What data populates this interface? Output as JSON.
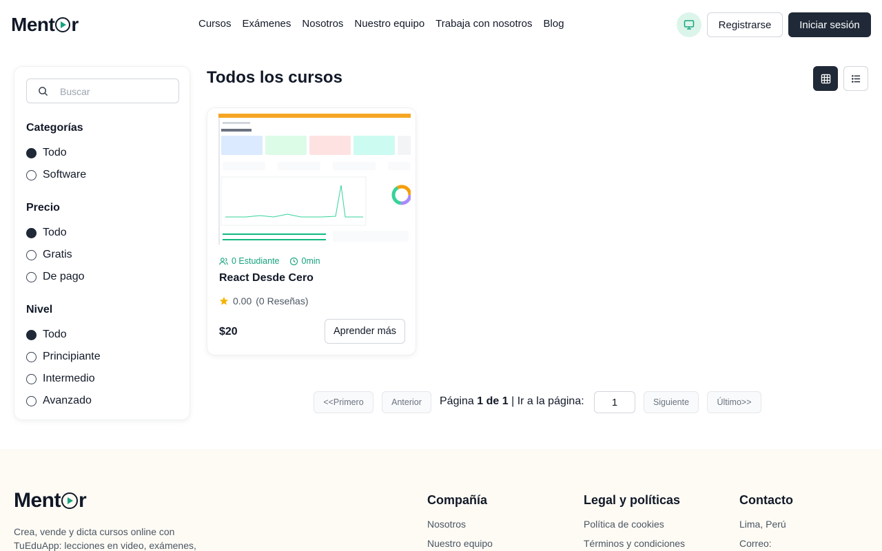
{
  "brand": {
    "name_prefix": "Ment",
    "name_suffix": "r"
  },
  "nav": [
    "Cursos",
    "Exámenes",
    "Nosotros",
    "Nuestro equipo",
    "Trabaja con nosotros",
    "Blog"
  ],
  "header": {
    "register_label": "Registrarse",
    "login_label": "Iniciar sesión"
  },
  "search": {
    "placeholder": "Buscar",
    "value": ""
  },
  "filters": {
    "categories": {
      "title": "Categorías",
      "options": [
        "Todo",
        "Software"
      ],
      "selected": "Todo"
    },
    "price": {
      "title": "Precio",
      "options": [
        "Todo",
        "Gratis",
        "De pago"
      ],
      "selected": "Todo"
    },
    "level": {
      "title": "Nivel",
      "options": [
        "Todo",
        "Principiante",
        "Intermedio",
        "Avanzado"
      ],
      "selected": "Todo"
    }
  },
  "main": {
    "title": "Todos los cursos",
    "view_mode": "grid"
  },
  "course": {
    "students": "0 Estudiante",
    "duration": "0min",
    "title": "React Desde Cero",
    "rating": "0.00",
    "reviews": "(0 Reseñas)",
    "price": "$20",
    "cta": "Aprender más"
  },
  "pagination": {
    "first": "<<Primero",
    "prev": "Anterior",
    "page_label": "Página",
    "current": "1 de 1",
    "separator": "|",
    "goto_label": "Ir a la página:",
    "goto_value": "1",
    "next": "Siguiente",
    "last": "Último>>"
  },
  "footer": {
    "description": "Crea, vende y dicta cursos online con TuEduApp: lecciones en video, exámenes,",
    "company": {
      "title": "Compañía",
      "links": [
        "Nosotros",
        "Nuestro equipo"
      ]
    },
    "legal": {
      "title": "Legal y políticas",
      "links": [
        "Política de cookies",
        "Términos y condiciones"
      ]
    },
    "contact": {
      "title": "Contacto",
      "links": [
        "Lima, Perú",
        "Correo:"
      ]
    }
  },
  "colors": {
    "accent": "#16a37f",
    "dark": "#1f2937",
    "footer_bg": "#fdfbf4",
    "star": "#f5b400"
  }
}
